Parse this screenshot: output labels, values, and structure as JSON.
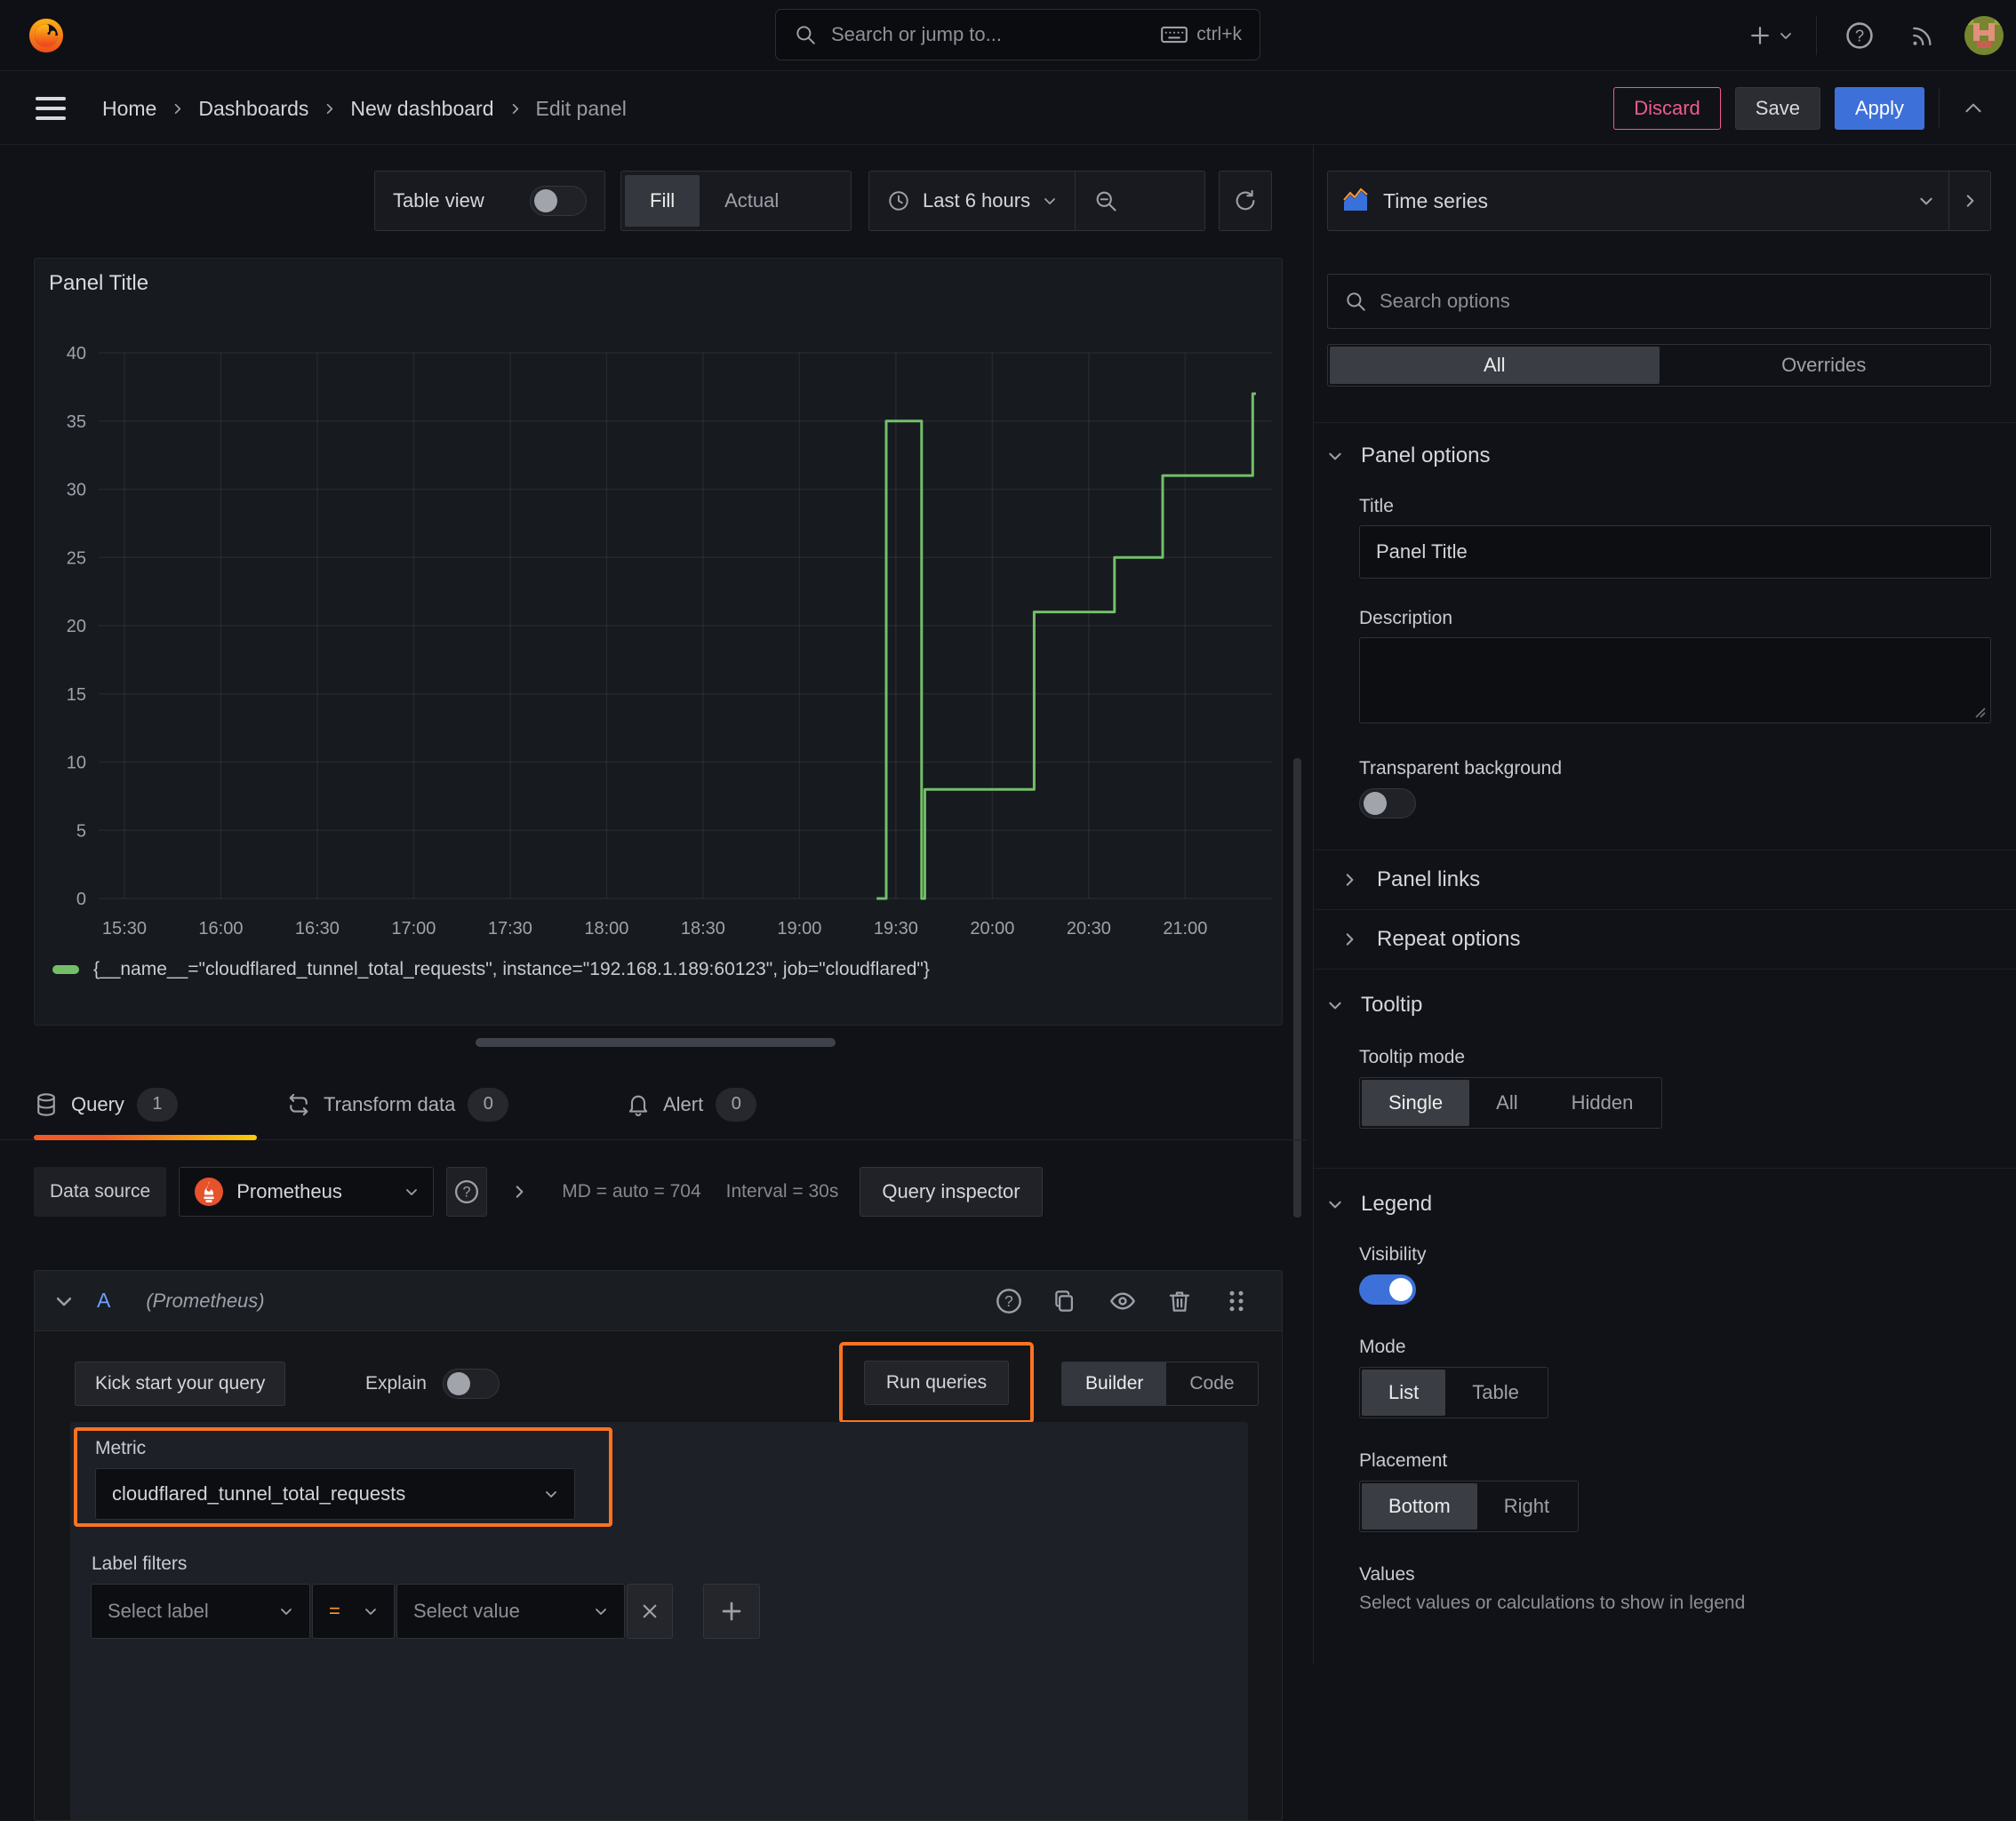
{
  "colors": {
    "accent_orange": "#ff7320",
    "blue": "#3d71d9",
    "green": "#73bf69",
    "pink": "#ef5b8c"
  },
  "topbar": {
    "search_placeholder": "Search or jump to...",
    "shortcut": "ctrl+k"
  },
  "breadcrumb": {
    "items": [
      {
        "label": "Home"
      },
      {
        "label": "Dashboards"
      },
      {
        "label": "New dashboard"
      },
      {
        "label": "Edit panel"
      }
    ]
  },
  "header_actions": {
    "discard": "Discard",
    "save": "Save",
    "apply": "Apply"
  },
  "panel_toolbar": {
    "table_view": "Table view",
    "fill": "Fill",
    "actual": "Actual",
    "time_range": "Last 6 hours"
  },
  "chart_data": {
    "type": "line",
    "title": "Panel Title",
    "x_range": [
      "15:22",
      "21:27"
    ],
    "xticks": [
      "15:30",
      "16:00",
      "16:30",
      "17:00",
      "17:30",
      "18:00",
      "18:30",
      "19:00",
      "19:30",
      "20:00",
      "20:30",
      "21:00"
    ],
    "ylim": [
      0,
      40
    ],
    "yticks": [
      0,
      5,
      10,
      15,
      20,
      25,
      30,
      35,
      40
    ],
    "grid": true,
    "legend_position": "bottom",
    "series": [
      {
        "name": "{__name__=\"cloudflared_tunnel_total_requests\", instance=\"192.168.1.189:60123\", job=\"cloudflared\"}",
        "color": "#73bf69",
        "points": [
          [
            "19:24",
            0
          ],
          [
            "19:27",
            0
          ],
          [
            "19:27",
            35
          ],
          [
            "19:38",
            35
          ],
          [
            "19:38",
            0
          ],
          [
            "19:39",
            0
          ],
          [
            "19:39",
            8
          ],
          [
            "20:13",
            8
          ],
          [
            "20:13",
            21
          ],
          [
            "20:38",
            21
          ],
          [
            "20:38",
            25
          ],
          [
            "20:53",
            25
          ],
          [
            "20:53",
            31
          ],
          [
            "21:21",
            31
          ],
          [
            "21:21",
            37
          ],
          [
            "21:22",
            37
          ]
        ]
      }
    ]
  },
  "query_section": {
    "tabs": [
      {
        "label": "Query",
        "count": "1"
      },
      {
        "label": "Transform data",
        "count": "0"
      },
      {
        "label": "Alert",
        "count": "0"
      }
    ],
    "datasource_bar": {
      "label": "Data source",
      "value": "Prometheus",
      "max_data_points": "MD = auto = 704",
      "interval": "Interval = 30s",
      "inspector": "Query inspector"
    },
    "query_row": {
      "ref_id": "A",
      "datasource_hint": "(Prometheus)"
    },
    "toolbar": {
      "kick_start": "Kick start your query",
      "explain": "Explain",
      "run_queries": "Run queries",
      "builder": "Builder",
      "code": "Code"
    },
    "builder": {
      "metric_label": "Metric",
      "metric_value": "cloudflared_tunnel_total_requests",
      "label_filters": "Label filters",
      "select_label": "Select label",
      "operator": "=",
      "select_value": "Select value"
    }
  },
  "sidebar": {
    "viz_type": "Time series",
    "search_placeholder": "Search options",
    "filter_tabs": {
      "all": "All",
      "overrides": "Overrides"
    },
    "panel_options": {
      "header": "Panel options",
      "title_label": "Title",
      "title_value": "Panel Title",
      "description_label": "Description",
      "transparent_label": "Transparent background"
    },
    "panel_links": "Panel links",
    "repeat_options": "Repeat options",
    "tooltip": {
      "header": "Tooltip",
      "mode_label": "Tooltip mode",
      "options": [
        "Single",
        "All",
        "Hidden"
      ],
      "selected": "Single"
    },
    "legend": {
      "header": "Legend",
      "visibility_label": "Visibility",
      "mode_label": "Mode",
      "modes": [
        "List",
        "Table"
      ],
      "selected_mode": "List",
      "placement_label": "Placement",
      "placements": [
        "Bottom",
        "Right"
      ],
      "selected_placement": "Bottom",
      "values_label": "Values",
      "values_help": "Select values or calculations to show in legend"
    }
  }
}
